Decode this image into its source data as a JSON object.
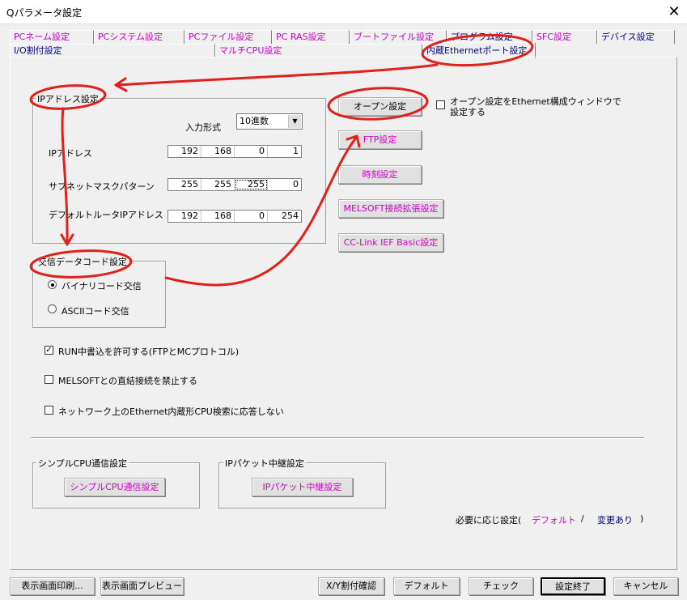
{
  "window": {
    "title": "Qパラメータ設定",
    "close_glyph": "✕"
  },
  "tabs_row1": [
    {
      "label": "PCネーム設定",
      "color": "pink"
    },
    {
      "label": "PCシステム設定",
      "color": "pink"
    },
    {
      "label": "PCファイル設定",
      "color": "pink"
    },
    {
      "label": "PC RAS設定",
      "color": "pink"
    },
    {
      "label": "ブートファイル設定",
      "color": "pink"
    },
    {
      "label": "プログラム設定",
      "color": "dark"
    },
    {
      "label": "SFC設定",
      "color": "pink"
    },
    {
      "label": "デバイス設定",
      "color": "dark"
    }
  ],
  "tabs_row2": [
    {
      "label": "I/O割付設定",
      "color": "dark"
    },
    {
      "label": "マルチCPU設定",
      "color": "pink"
    },
    {
      "label": "内蔵Ethernetポート設定",
      "color": "dark",
      "active": true
    }
  ],
  "ip_group": {
    "title": "IPアドレス設定",
    "input_format_label": "入力形式",
    "input_format_value": "10進数",
    "ip_label": "IPアドレス",
    "ip": [
      "192",
      "168",
      "0",
      "1"
    ],
    "subnet_label": "サブネットマスクパターン",
    "subnet": [
      "255",
      "255",
      "255",
      "0"
    ],
    "gateway_label": "デフォルトルータIPアドレス",
    "gateway": [
      "192",
      "168",
      "0",
      "254"
    ]
  },
  "right_buttons": {
    "open_settings": "オープン設定",
    "open_in_ethernet_label_line1": "オープン設定をEthernet構成ウィンドウで",
    "open_in_ethernet_label_line2": "設定する",
    "ftp": "FTP設定",
    "time": "時刻設定",
    "melsoft_ext": "MELSOFT接続拡張設定",
    "cclink": "CC-Link IEF Basic設定"
  },
  "comm_code_group": {
    "title": "交信データコード設定",
    "binary": "バイナリコード交信",
    "ascii": "ASCIIコード交信",
    "selected": "binary"
  },
  "checkboxes": {
    "run_write": {
      "label": "RUN中書込を許可する(FTPとMCプロトコル)",
      "checked": true
    },
    "melsoft_direct": {
      "label": "MELSOFTとの直結接続を禁止する",
      "checked": false
    },
    "no_search_response": {
      "label": "ネットワーク上のEthernet内蔵形CPU検索に応答しない",
      "checked": false
    }
  },
  "simple_cpu_group": {
    "title": "シンプルCPU通信設定",
    "button": "シンプルCPU通信設定"
  },
  "ip_packet_group": {
    "title": "IPパケット中継設定",
    "button": "IPパケット中継設定"
  },
  "legend": {
    "prefix": "必要に応じ設定(",
    "default": "デフォルト",
    "separator": "/",
    "changed": "変更あり",
    "suffix": ")"
  },
  "footer": {
    "print": "表示画面印刷...",
    "preview": "表示画面プレビュー",
    "xy_check": "X/Y割付確認",
    "default": "デフォルト",
    "check": "チェック",
    "finish": "設定終了",
    "cancel": "キャンセル"
  },
  "colors": {
    "pink_text": "#d000c8",
    "navy_text": "#000080",
    "annotation_red": "#e0201a",
    "dialog_bg": "#f0f0f0"
  }
}
